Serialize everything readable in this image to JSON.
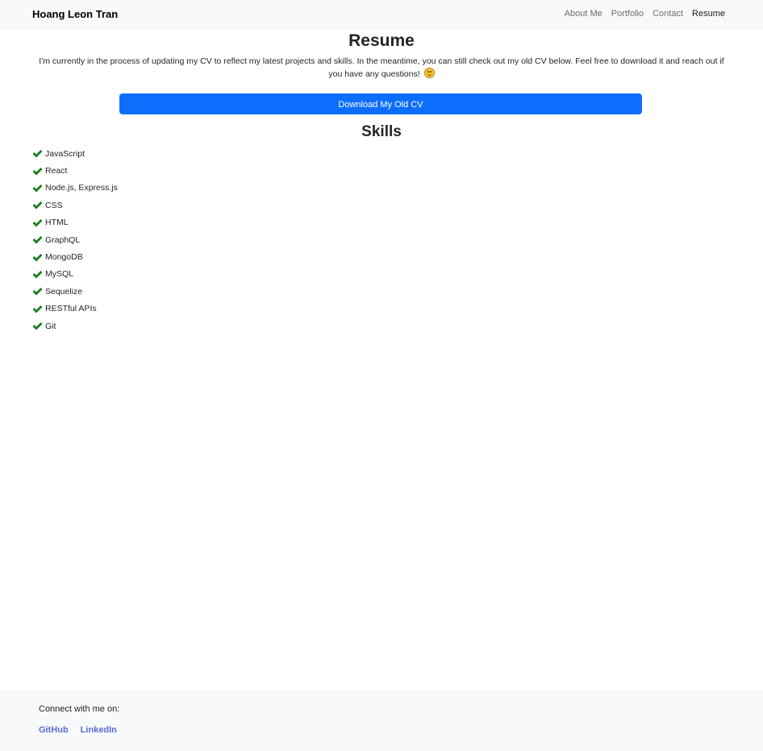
{
  "navbar": {
    "brand": "Hoang Leon Tran",
    "links": [
      {
        "label": "About Me",
        "active": false
      },
      {
        "label": "Portfolio",
        "active": false
      },
      {
        "label": "Contact",
        "active": false
      },
      {
        "label": "Resume",
        "active": true
      }
    ]
  },
  "main": {
    "title": "Resume",
    "intro_line1": "I'm currently in the process of updating my CV to reflect my latest projects and skills. In the meantime, you can still check out my old CV below. Feel free to download it and reach out if",
    "intro_line2": "you have any questions!",
    "emoji_icon": "smiling-face-icon",
    "download_label": "Download My Old CV",
    "skills_title": "Skills",
    "skills": [
      "JavaScript",
      "React",
      "Node.js, Express.js",
      "CSS",
      "HTML",
      "GraphQL",
      "MongoDB",
      "MySQL",
      "Sequelize",
      "RESTful APIs",
      "Git"
    ],
    "skill_icon": "check-icon"
  },
  "footer": {
    "label": "Connect with me on:",
    "links": [
      "GitHub",
      "LinkedIn"
    ]
  },
  "colors": {
    "accent": "#0d6efd",
    "check": "#1a7f1a",
    "footer_link": "#5a6bd8",
    "nav_bg": "#f8f9fa"
  }
}
